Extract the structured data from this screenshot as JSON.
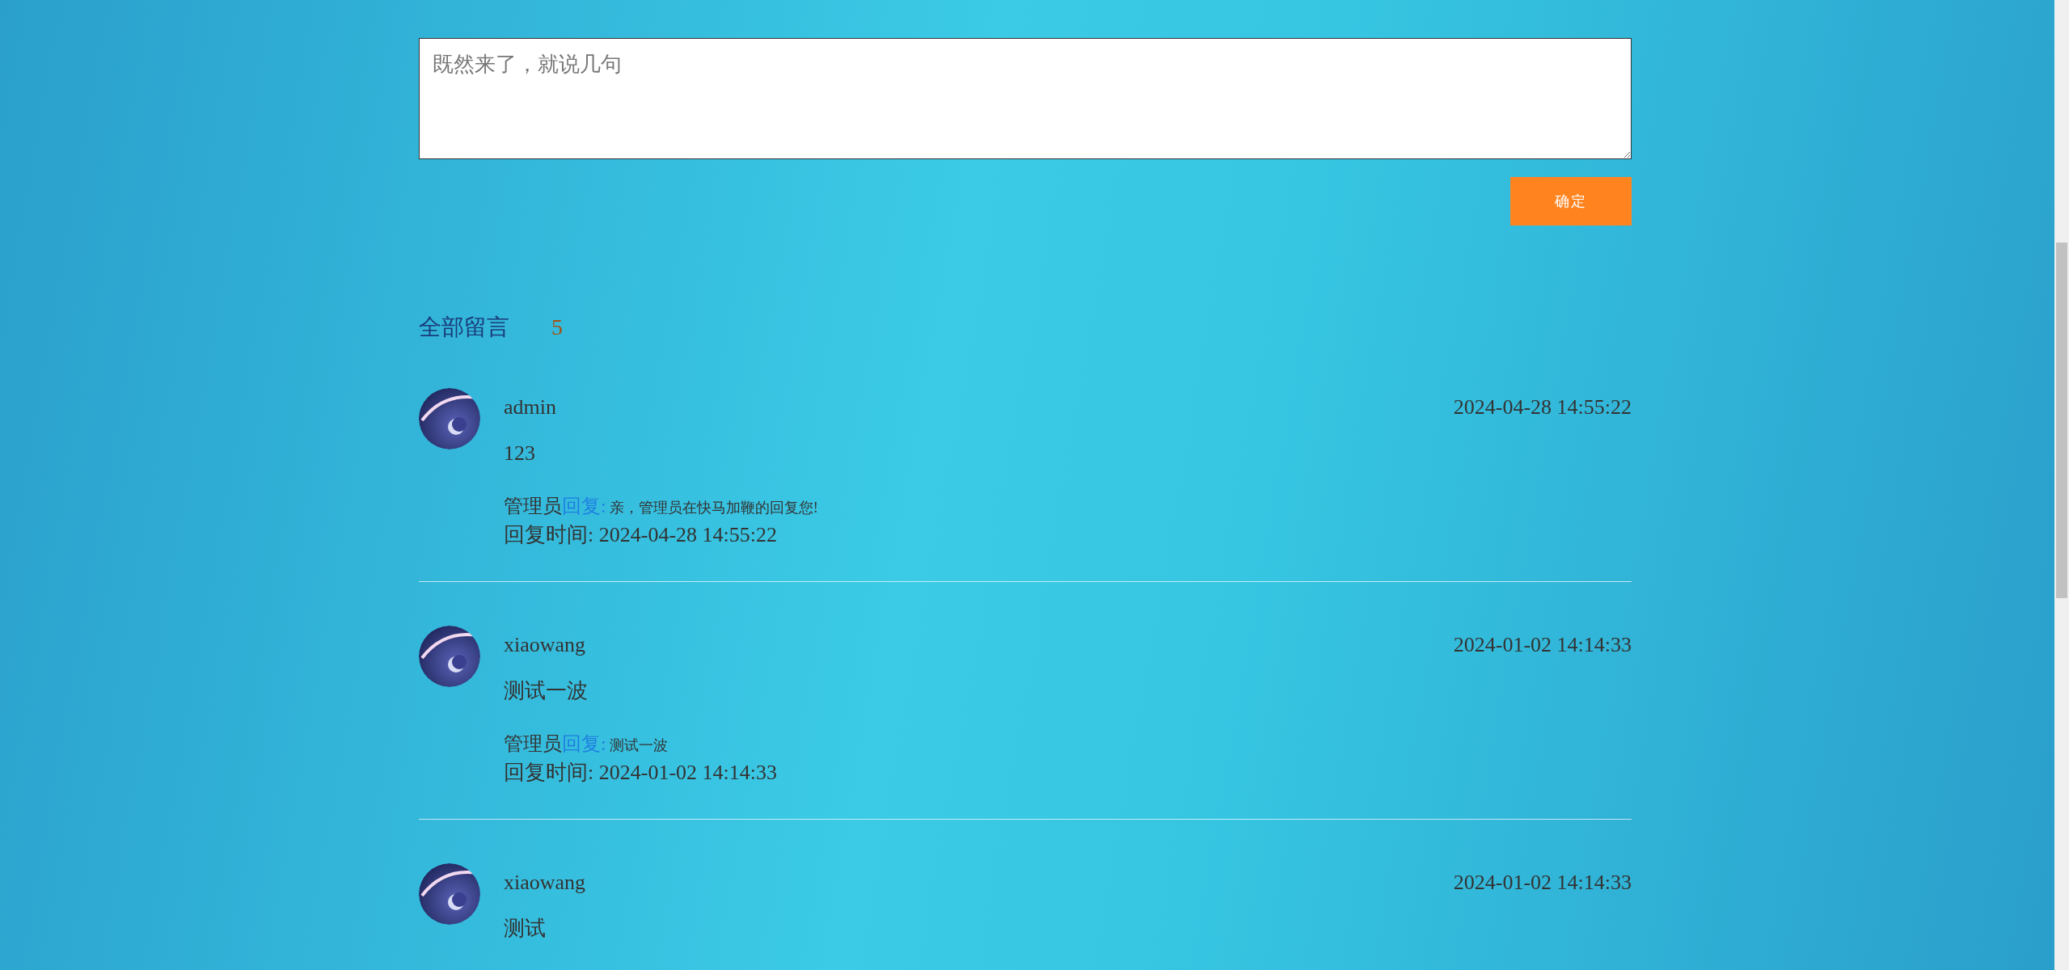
{
  "comment_box": {
    "placeholder": "既然来了，就说几句"
  },
  "submit_button": "确定",
  "heading": {
    "label": "全部留言",
    "count": "5"
  },
  "comments": [
    {
      "author": "admin",
      "time": "2024-04-28 14:55:22",
      "content": "123",
      "reply": {
        "by": "管理员",
        "action": "回复:",
        "text": "亲，管理员在快马加鞭的回复您!",
        "time": "回复时间: 2024-04-28 14:55:22"
      }
    },
    {
      "author": "xiaowang",
      "time": "2024-01-02 14:14:33",
      "content": "测试一波",
      "reply": {
        "by": "管理员",
        "action": "回复:",
        "text": "测试一波",
        "time": "回复时间: 2024-01-02 14:14:33"
      }
    },
    {
      "author": "xiaowang",
      "time": "2024-01-02 14:14:33",
      "content": "测试"
    }
  ]
}
